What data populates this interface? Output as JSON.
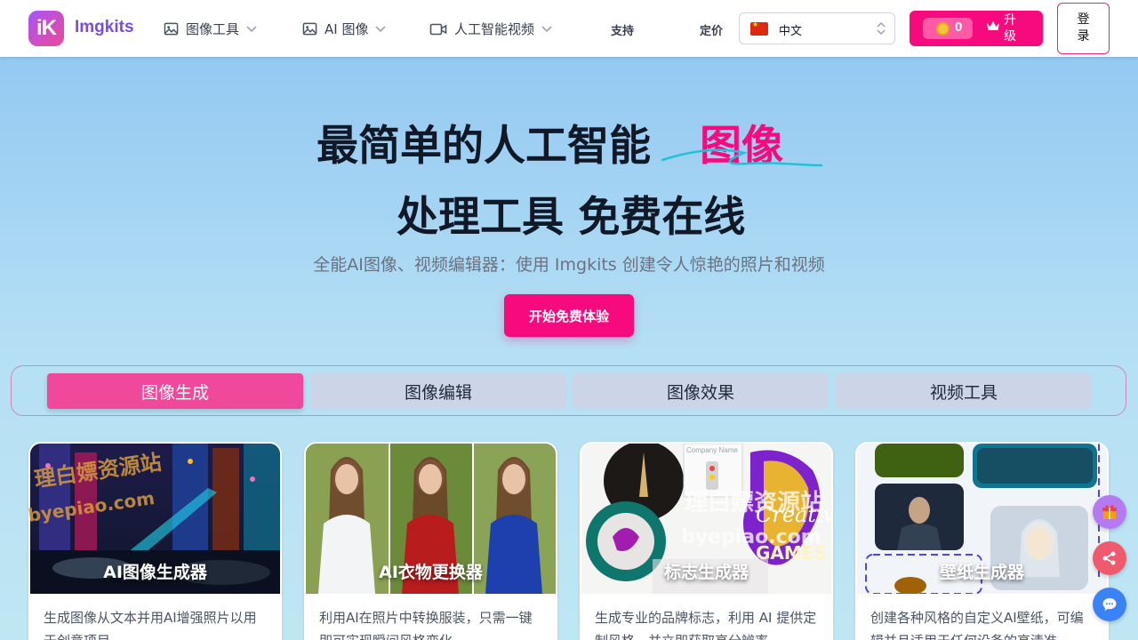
{
  "nav": {
    "logo_text": "iK",
    "brand": "Imgkits",
    "menus": [
      {
        "label": "图像工具",
        "icon": "image-icon"
      },
      {
        "label": "AI 图像",
        "icon": "image-icon"
      },
      {
        "label": "人工智能视频",
        "icon": "video-camera-icon"
      }
    ],
    "support": "支持",
    "pricing": "定价",
    "language": "中文",
    "credits": "0",
    "upgrade": "升级",
    "login": "登录"
  },
  "hero": {
    "title_line1": "最简单的人工智能",
    "title_accent": "图像",
    "title_line2": "处理工具 免费在线",
    "subtitle": "全能AI图像、视频编辑器：使用 Imgkits 创建令人惊艳的照片和视频",
    "cta": "开始免费体验"
  },
  "tabs": [
    "图像生成",
    "图像编辑",
    "图像效果",
    "视频工具"
  ],
  "active_tab": 0,
  "cards": [
    {
      "title": "AI图像生成器",
      "desc": "生成图像从文本并用AI增强照片以用于创意项目"
    },
    {
      "title": "AI衣物更换器",
      "desc": "利用AI在照片中转换服装，只需一键即可实现瞬间风格变化"
    },
    {
      "title": "标志生成器",
      "desc": "生成专业的品牌标志，利用 AI 提供定制风格，并立即获取高分辨率"
    },
    {
      "title": "壁纸生成器",
      "desc": "创建各种风格的自定义AI壁纸，可编辑并且适用于任何设备的高清准"
    }
  ],
  "logo_card_text": {
    "company": "Company Name",
    "creative": "Creative",
    "games": "GAMES"
  },
  "watermark": {
    "cn": "理白嫖资源站",
    "url": "byepiao.com"
  },
  "colors": {
    "accent": "#f60a7d",
    "tab_active": "#f0489a",
    "tab_inactive": "#cbd5e7",
    "brand": "#7c4dd8"
  }
}
